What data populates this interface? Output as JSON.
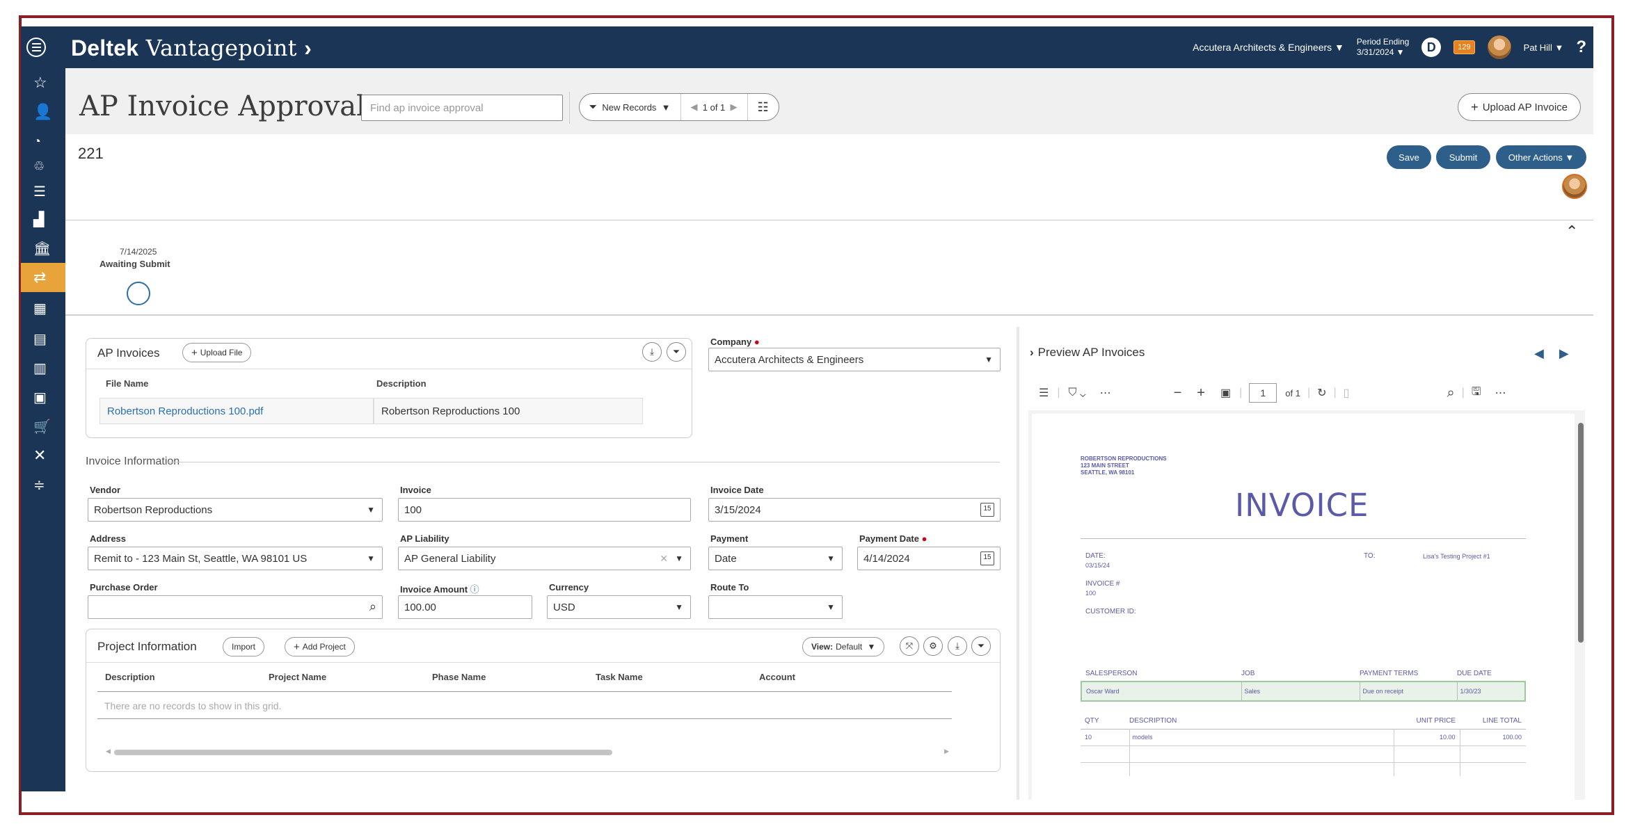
{
  "app": {
    "brand_bold": "Deltek",
    "brand_rest": "Vantagepoint",
    "company": "Accutera Architects & Engineers",
    "period_label": "Period Ending",
    "period_value": "3/31/2024",
    "notifications": "129",
    "user": "Pat Hill",
    "help": "?"
  },
  "header": {
    "title": "AP Invoice Approvals",
    "search_placeholder": "Find ap invoice approval",
    "filter_label": "New Records",
    "pager_text": "1 of 1",
    "upload_label": "Upload AP Invoice"
  },
  "record": {
    "number": "221",
    "save": "Save",
    "submit": "Submit",
    "other_actions": "Other Actions"
  },
  "workflow": {
    "date": "7/14/2025",
    "status": "Awaiting Submit"
  },
  "ap_invoices": {
    "title": "AP Invoices",
    "upload_file": "Upload File",
    "col_file": "File Name",
    "col_desc": "Description",
    "row_file": "Robertson Reproductions 100.pdf",
    "row_desc": "Robertson Reproductions 100"
  },
  "company_field": {
    "label": "Company",
    "value": "Accutera Architects & Engineers"
  },
  "invoice_info": {
    "section": "Invoice Information",
    "vendor_label": "Vendor",
    "vendor": "Robertson Reproductions",
    "invoice_label": "Invoice",
    "invoice": "100",
    "invoice_date_label": "Invoice Date",
    "invoice_date": "3/15/2024",
    "address_label": "Address",
    "address": "Remit to - 123 Main St, Seattle, WA 98101 US",
    "liability_label": "AP Liability",
    "liability": "AP General Liability",
    "payment_label": "Payment",
    "payment": "Date",
    "payment_date_label": "Payment Date",
    "payment_date": "4/14/2024",
    "po_label": "Purchase Order",
    "po": "",
    "amount_label": "Invoice Amount",
    "amount": "100.00",
    "currency_label": "Currency",
    "currency": "USD",
    "route_label": "Route To",
    "route": ""
  },
  "project_info": {
    "title": "Project Information",
    "import": "Import",
    "add_project": "Add Project",
    "view_label": "View:",
    "view_value": "Default",
    "columns": [
      "Description",
      "Project Name",
      "Phase Name",
      "Task Name",
      "Account"
    ],
    "empty": "There are no records to show in this grid."
  },
  "preview": {
    "title": "Preview AP Invoices",
    "page_input": "1",
    "page_of": "of 1",
    "doc": {
      "vendor_lines": [
        "ROBERTSON REPRODUCTIONS",
        "123 MAIN STREET",
        "SEATTLE, WA 98101"
      ],
      "title": "INVOICE",
      "date_label": "DATE:",
      "date": "03/15/24",
      "to_label": "TO:",
      "to": "Lisa's Testing Project #1",
      "invoice_label": "INVOICE #",
      "invoice": "100",
      "customer_label": "CUSTOMER ID:",
      "headers1": [
        "SALESPERSON",
        "JOB",
        "PAYMENT TERMS",
        "DUE DATE"
      ],
      "row1": [
        "Oscar Ward",
        "Sales",
        "Due on receipt",
        "1/30/23"
      ],
      "headers2": [
        "QTY",
        "DESCRIPTION",
        "UNIT PRICE",
        "LINE TOTAL"
      ],
      "row2": [
        "10",
        "models",
        "10.00",
        "100.00"
      ]
    }
  },
  "icons": {
    "nav": [
      "star-icon",
      "contact-icon",
      "dashboard-icon",
      "reports-icon",
      "list-icon",
      "chart-icon",
      "bank-icon",
      "transactions-icon",
      "org-icon",
      "building-icon",
      "books-icon",
      "hierarchy-icon",
      "cart-icon",
      "tools-icon",
      "settings-sliders-icon"
    ]
  }
}
